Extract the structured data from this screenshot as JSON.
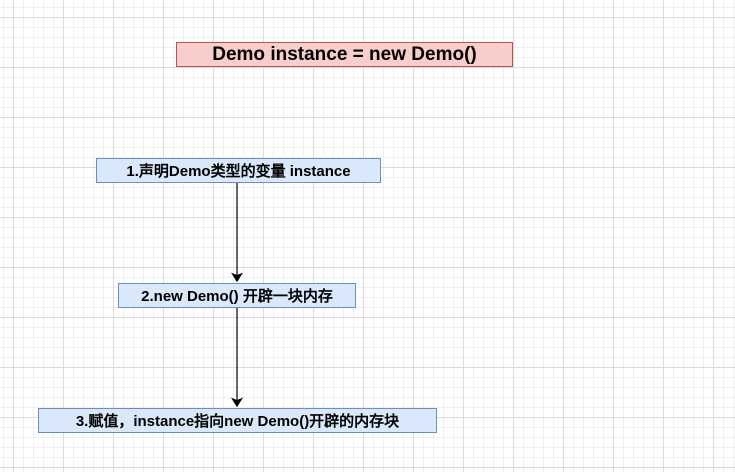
{
  "title": "Demo instance = new Demo()",
  "steps": [
    {
      "label": "1.声明Demo类型的变量 instance"
    },
    {
      "label": "2.new Demo() 开辟一块内存"
    },
    {
      "label": "3.赋值，instance指向new Demo()开辟的内存块"
    }
  ],
  "colors": {
    "title_fill": "#f8cecc",
    "title_stroke": "#b85450",
    "step_fill": "#dae8fc",
    "step_stroke": "#6c8ebf"
  }
}
